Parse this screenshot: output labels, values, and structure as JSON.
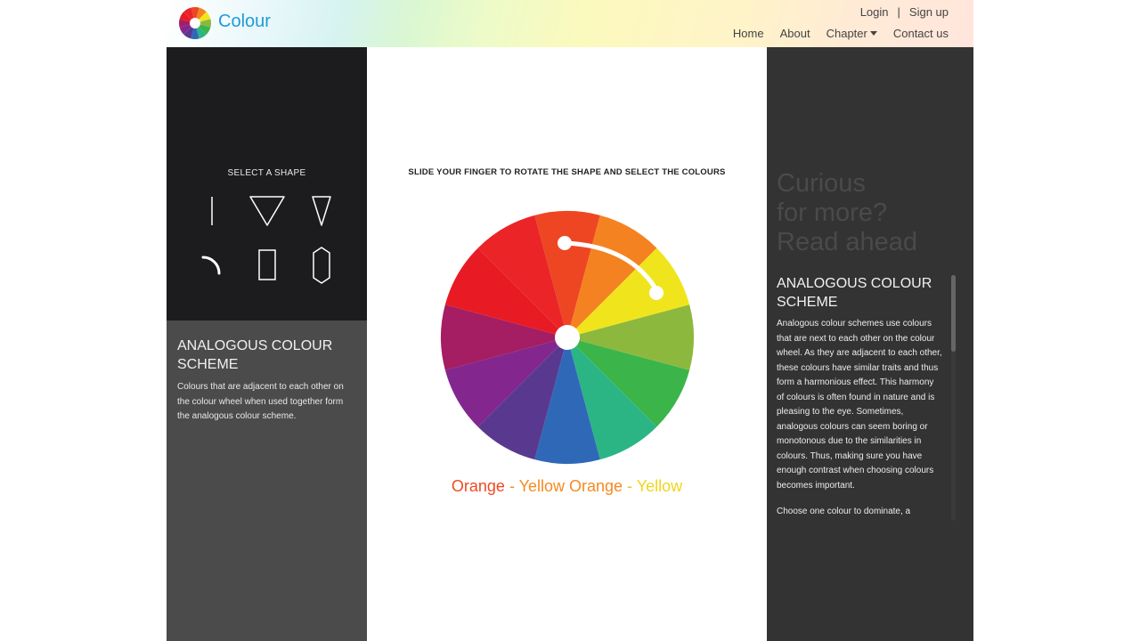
{
  "header": {
    "brand": "Colour",
    "login": "Login",
    "separator": "|",
    "signup": "Sign up",
    "nav": [
      "Home",
      "About",
      "Chapter",
      "Contact us"
    ]
  },
  "left": {
    "select_title": "SELECT A SHAPE",
    "shapes": [
      "line-shape-icon",
      "wide-triangle-shape-icon",
      "narrow-triangle-shape-icon",
      "arc-shape-icon",
      "rectangle-shape-icon",
      "hexagon-shape-icon"
    ],
    "scheme_title": "ANALOGOUS COLOUR SCHEME",
    "scheme_text": "Colours that are adjacent to each other on the colour wheel when used together form the analogous colour scheme."
  },
  "center": {
    "instruction": "SLIDE YOUR FINGER TO ROTATE THE SHAPE AND SELECT THE COLOURS",
    "wheel_colors": [
      "#EE4623",
      "#F58220",
      "#F0E51D",
      "#8DB83E",
      "#3BB54A",
      "#2BB585",
      "#3068B8",
      "#59398F",
      "#83278F",
      "#A51D62",
      "#E81B25",
      "#EA2427"
    ],
    "selected": [
      {
        "name": "Orange",
        "color": "#EE4A23"
      },
      {
        "name": "Yellow Orange",
        "color": "#F58A20"
      },
      {
        "name": "Yellow",
        "color": "#F0E51D"
      }
    ],
    "separator": " - "
  },
  "right": {
    "curious": [
      "Curious",
      "for more?",
      "Read ahead"
    ],
    "title": "ANALOGOUS COLOUR SCHEME",
    "text": "Analogous colour schemes use colours that are next to each other on the colour wheel. As they are adjacent to each other, these colours have similar traits and thus form a harmonious effect. This harmony of colours is often found in nature and is pleasing to the eye. Sometimes, analogous colours can seem boring or monotonous due to the similarities in colours. Thus, making sure you have enough contrast when choosing colours becomes important.",
    "text2": "Choose one colour to dominate, a"
  }
}
